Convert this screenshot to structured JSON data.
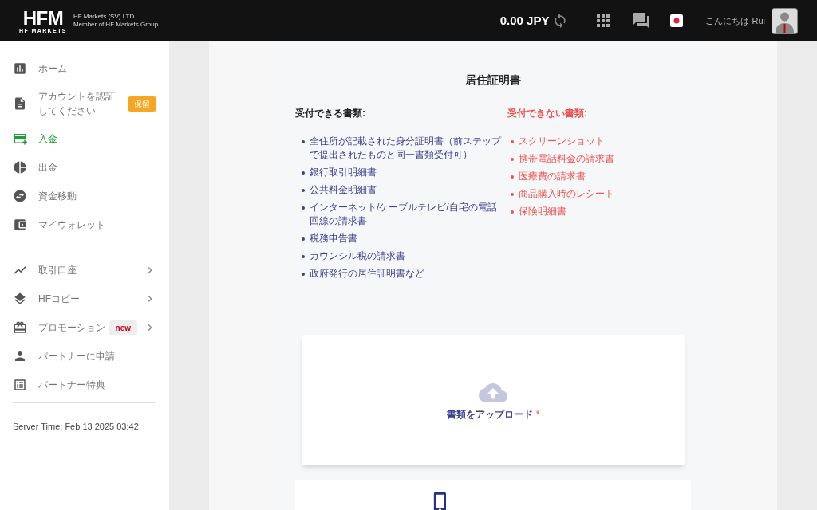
{
  "header": {
    "logo_mark": "HFM",
    "logo_sub": "HF MARKETS",
    "company_lines": [
      "HF Markets (SV) LTD",
      "Member of HF Markets Group"
    ],
    "balance": "0.00 JPY",
    "greeting": "こんにちは Rui"
  },
  "sidebar": {
    "groups": [
      [
        {
          "label": "ホーム",
          "kind": "link",
          "selected": false
        },
        {
          "label": "アカウントを認証してください",
          "kind": "link",
          "selected": false,
          "badge": {
            "text": "保留",
            "kind": "warning"
          }
        },
        {
          "label": "入金",
          "kind": "link",
          "selected": true
        },
        {
          "label": "出金",
          "kind": "link",
          "selected": false
        },
        {
          "label": "資金移動",
          "kind": "link",
          "selected": false
        },
        {
          "label": "マイウォレット",
          "kind": "link",
          "selected": false
        }
      ],
      [
        {
          "label": "取引口座",
          "kind": "submenu",
          "selected": false
        },
        {
          "label": "HFコピー",
          "kind": "submenu",
          "selected": false
        },
        {
          "label": "プロモーション",
          "kind": "submenu",
          "selected": false,
          "badge": {
            "text": "new",
            "kind": "new"
          }
        },
        {
          "label": "パートナーに申請",
          "kind": "link",
          "selected": false
        },
        {
          "label": "パートナー特典",
          "kind": "link",
          "selected": false
        }
      ]
    ],
    "server_time": "Server Time: Feb 13 2025 03:42"
  },
  "document": {
    "title": "居住証明書",
    "accepted": {
      "heading": "受付できる書類:",
      "items": [
        "全住所が記載された身分証明書（前ステップで提出されたものと同一書類受付可）",
        "銀行取引明細書",
        "公共料金明細書",
        "インターネット/ケーブルテレビ/自宅の電話回線の請求書",
        "税務申告書",
        "カウンシル税の請求書",
        "政府発行の居住証明書など"
      ]
    },
    "rejected": {
      "heading": "受付できない書類:",
      "items": [
        "スクリーンショット",
        "携帯電話料金の請求書",
        "医療費の請求書",
        "商品購入時のレシート",
        "保険明細書"
      ]
    },
    "upload": {
      "label": "書類をアップロード",
      "required": true,
      "required_mark": "*"
    }
  }
}
